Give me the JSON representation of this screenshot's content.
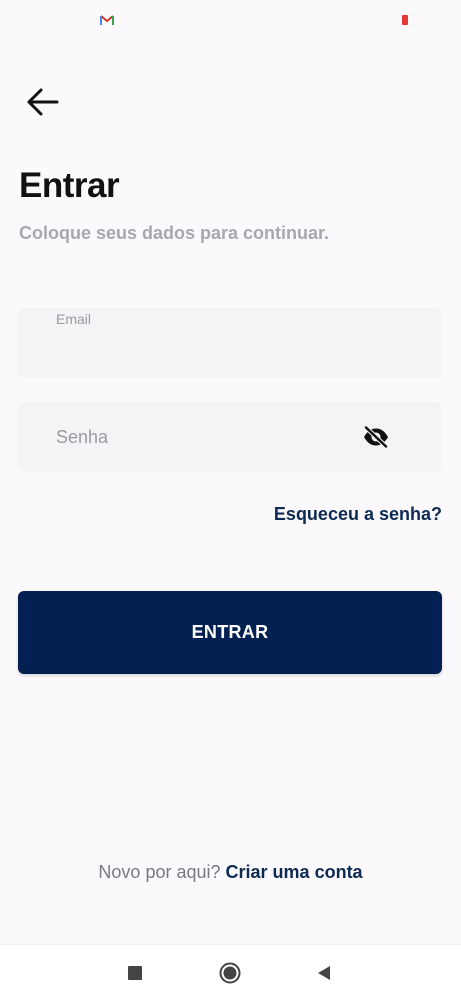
{
  "screen": {
    "title": "Entrar",
    "subtitle": "Coloque seus dados para continuar."
  },
  "email_field": {
    "label": "Email",
    "value": ""
  },
  "password_field": {
    "placeholder": "Senha",
    "value": "",
    "toggle_icon": "eye-off-icon"
  },
  "forgot_password": {
    "label": "Esqueceu a senha?"
  },
  "submit": {
    "label": "ENTRAR"
  },
  "signup": {
    "prompt": "Novo por aqui?",
    "link": "Criar uma conta"
  },
  "colors": {
    "primary": "#022152",
    "link": "#0d2a52",
    "background": "#fbf9fc",
    "field_background": "#f5f3f6",
    "muted_text": "#a8a8ac"
  },
  "icons": {
    "back": "arrow-left-icon",
    "status_gmail": "gmail-icon",
    "status_battery": "battery-icon",
    "nav_recents": "square-icon",
    "nav_home": "circle-icon",
    "nav_back": "triangle-icon"
  }
}
